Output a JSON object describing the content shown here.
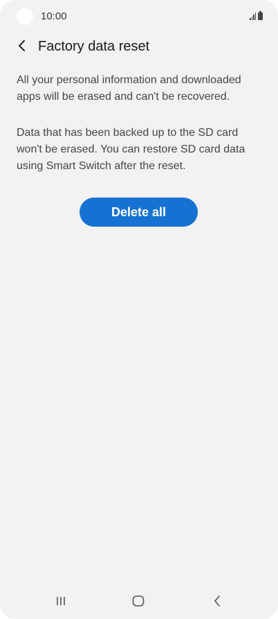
{
  "status_bar": {
    "time": "10:00",
    "icons": [
      "camera-cutout",
      "signal-icon",
      "battery-icon"
    ]
  },
  "header": {
    "title": "Factory data reset",
    "back_icon": "chevron-left-icon"
  },
  "main": {
    "paragraphs": [
      "All your personal information and downloaded apps will be erased and can't be recovered.",
      "Data that has been backed up to the SD card won't be erased. You can restore SD card data using Smart Switch after the reset."
    ],
    "delete_button_label": "Delete all"
  },
  "nav_bar": {
    "items": [
      "recent-apps-icon",
      "home-icon",
      "back-icon"
    ]
  },
  "colors": {
    "background": "#f2f2f2",
    "accent": "#1572d3",
    "text_primary": "#1a1a1a",
    "text_secondary": "#454545"
  }
}
